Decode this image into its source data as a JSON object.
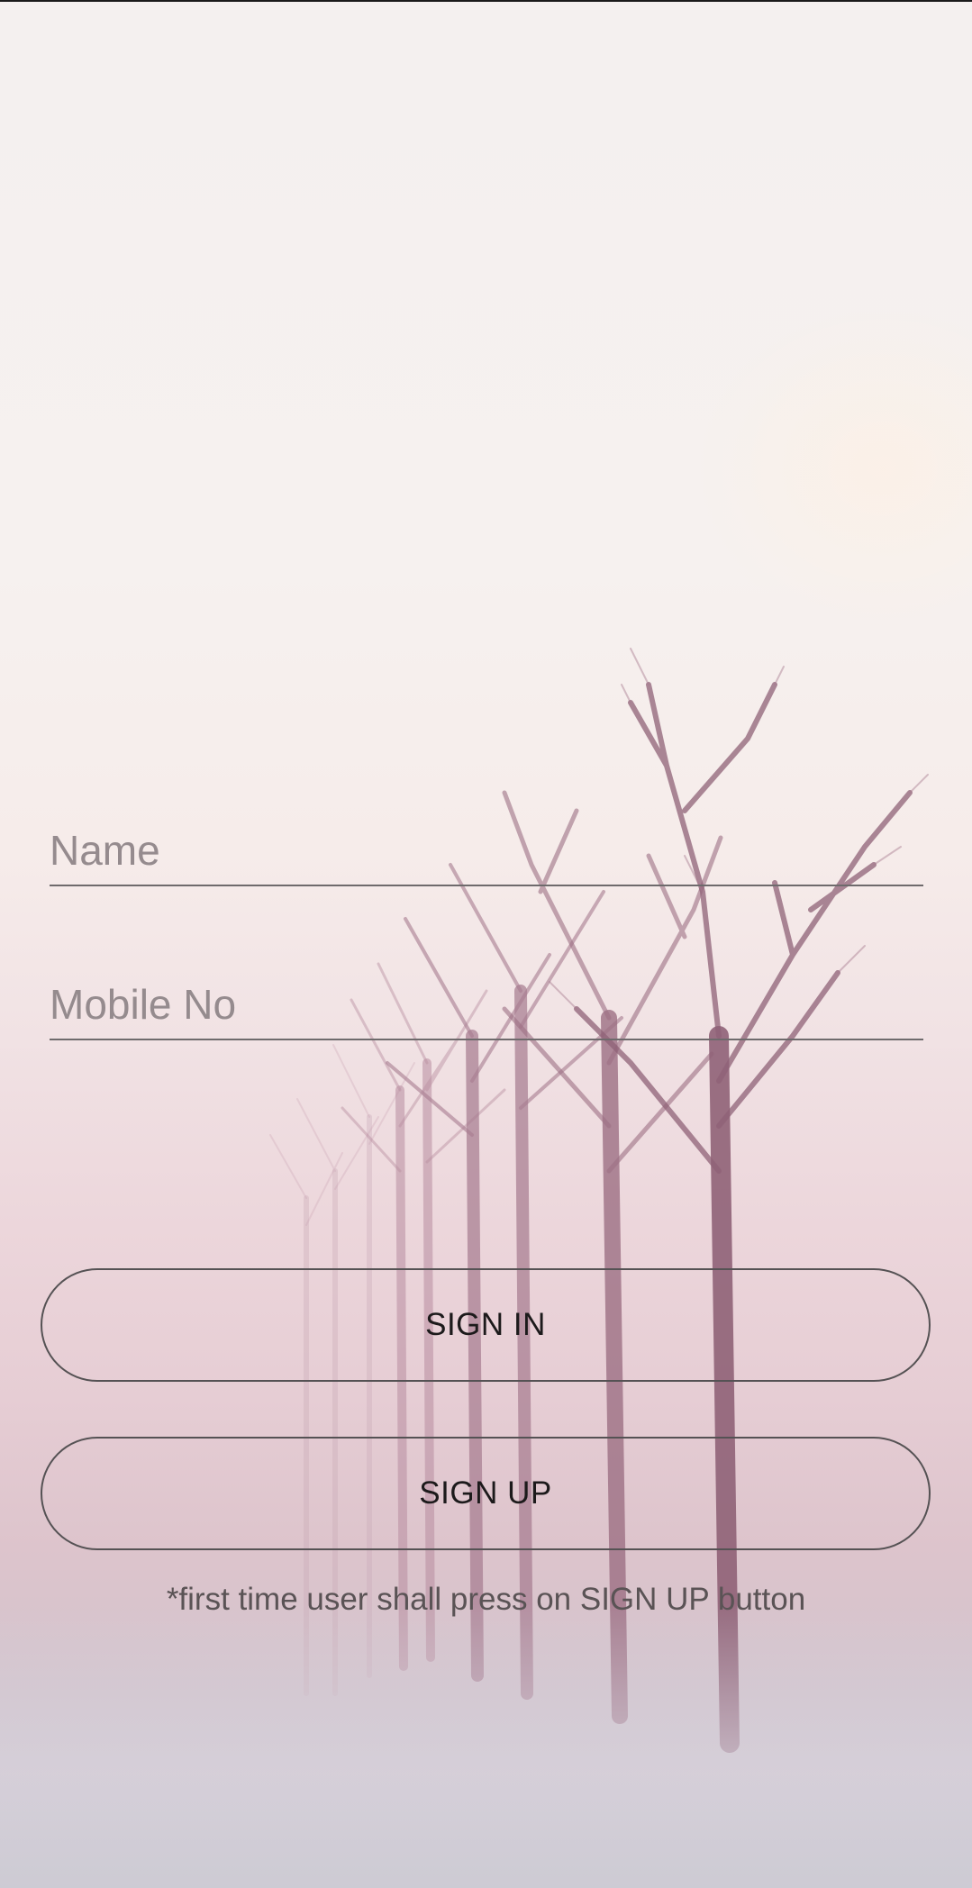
{
  "form": {
    "name_placeholder": "Name",
    "name_value": "",
    "mobile_placeholder": "Mobile No",
    "mobile_value": ""
  },
  "buttons": {
    "sign_in_label": "SIGN IN",
    "sign_up_label": "SIGN UP"
  },
  "note": "*first time user shall press on SIGN UP button",
  "background": {
    "image_subject": "misty-tree-row",
    "tint_color": "#e6cdd4"
  }
}
